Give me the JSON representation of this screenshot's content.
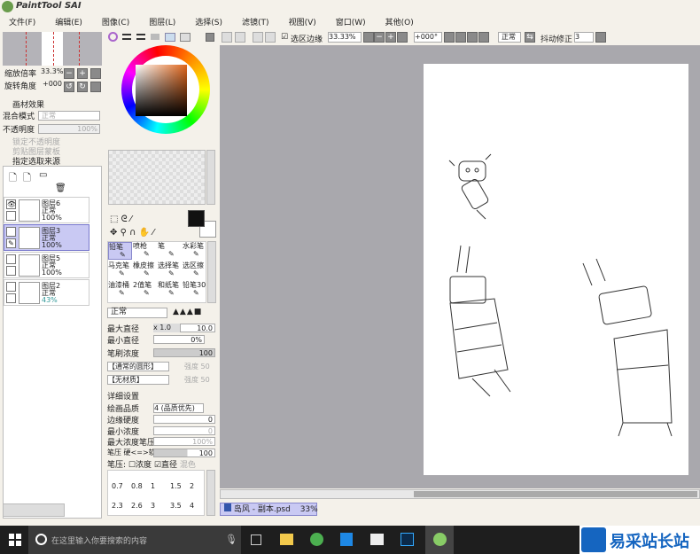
{
  "app": {
    "title": "PaintTool SAI"
  },
  "menu": [
    "文件(F)",
    "编辑(E)",
    "图像(C)",
    "图层(L)",
    "选择(S)",
    "滤镜(T)",
    "视图(V)",
    "窗口(W)",
    "其他(O)"
  ],
  "navigator": {
    "zoom_label": "缩放倍率",
    "zoom_value": "33.3%",
    "rotate_label": "旋转角度",
    "rotate_value": "+000"
  },
  "layer_props": {
    "effects": "画材效果",
    "blend_label": "混合模式",
    "blend_value": "正常",
    "opacity_label": "不透明度",
    "opacity_value": "100%",
    "lock_opacity": "锁定不透明度",
    "clip_group": "剪贴图层蒙板",
    "selection_source": "指定选取来源"
  },
  "layers": [
    {
      "name": "图层6",
      "mode": "正常",
      "opacity": "100%",
      "visible": true,
      "selected": false
    },
    {
      "name": "图层3",
      "mode": "正常",
      "opacity": "100%",
      "visible": false,
      "selected": true
    },
    {
      "name": "图层5",
      "mode": "正常",
      "opacity": "100%",
      "visible": false,
      "selected": false
    },
    {
      "name": "图层2",
      "mode": "正常",
      "opacity": "43%",
      "visible": false,
      "selected": false
    }
  ],
  "tools": [
    "铅笔",
    "喷枪",
    "笔",
    "水彩笔",
    "马克笔",
    "橡皮擦",
    "选择笔",
    "选区擦",
    "油漆桶",
    "2值笔",
    "和纸笔",
    "铅笔30"
  ],
  "brush": {
    "mode": "正常",
    "max_size_label": "最大直径",
    "max_size_mult": "x 1.0",
    "max_size": "10.0",
    "min_size_label": "最小直径",
    "min_size": "0%",
    "density_label": "笔刷浓度",
    "density": "100",
    "shape": "【通常的圆形】",
    "shape_val": "强度 50",
    "texture": "【无材质】",
    "texture_val": "强度 50"
  },
  "details": {
    "title": "详细设置",
    "quality_label": "绘画品质",
    "quality": "4 (品质优先)",
    "edge_label": "边缘硬度",
    "edge": "0",
    "min_density_label": "最小浓度",
    "min_density": "0",
    "max_pressure_label": "最大浓度笔压",
    "max_pressure": "100%",
    "pressure_label": "笔压 硬<=>软",
    "pressure": "100",
    "pressure_opts": "笔压:",
    "opt_density": "浓度",
    "opt_size": "直径",
    "opt_blend": "混色"
  },
  "sizes_row1": [
    "0.7",
    "0.8",
    "1",
    "1.5",
    "2"
  ],
  "sizes_row2": [
    "2.3",
    "2.6",
    "3",
    "3.5",
    "4"
  ],
  "toolbar": {
    "selection_edge": "选区边缘",
    "zoom": "33.33%",
    "angle": "+000°",
    "mode": "正常",
    "stabilizer_label": "抖动修正",
    "stabilizer": "3"
  },
  "document_tab": {
    "name": "岛风 - 副本.psd",
    "zoom": "33%"
  },
  "taskbar": {
    "search_placeholder": "在这里输入你要搜索的内容"
  },
  "watermark": "易采站长站",
  "colors": {
    "selected": "#c9c9f3",
    "canvas_bg": "#a9a8ad",
    "taskbar": "#1e1e1e"
  }
}
